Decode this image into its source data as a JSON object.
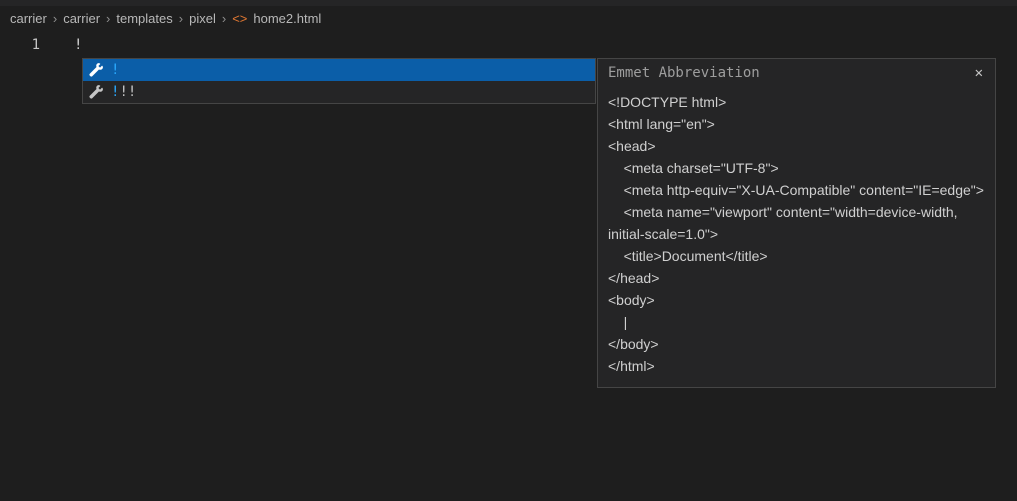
{
  "breadcrumb": {
    "items": [
      "carrier",
      "carrier",
      "templates",
      "pixel"
    ],
    "filename": "home2.html"
  },
  "editor": {
    "line_numbers": [
      "1"
    ],
    "code": "!"
  },
  "suggestions": {
    "items": [
      {
        "label_highlight": "!",
        "label_rest": ""
      },
      {
        "label_highlight": "!",
        "label_rest": "!!"
      }
    ]
  },
  "documentation": {
    "title": "Emmet Abbreviation",
    "body": "<!DOCTYPE html>\n<html lang=\"en\">\n<head>\n    <meta charset=\"UTF-8\">\n    <meta http-equiv=\"X-UA-Compatible\" content=\"IE=edge\">\n    <meta name=\"viewport\" content=\"width=device-width, initial-scale=1.0\">\n    <title>Document</title>\n</head>\n<body>\n    |\n</body>\n</html>"
  }
}
